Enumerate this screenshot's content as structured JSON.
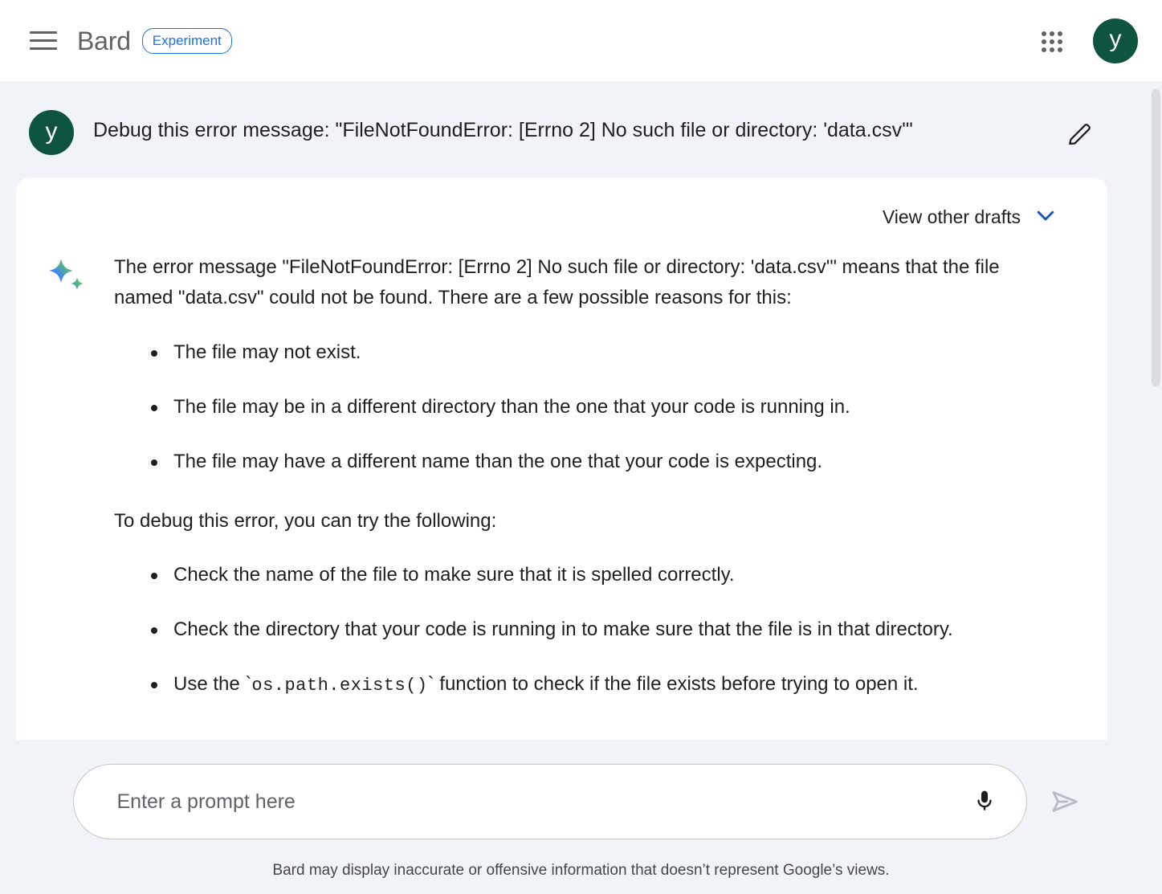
{
  "header": {
    "menu_icon": "hamburger-menu-icon",
    "brand": "Bard",
    "badge": "Experiment",
    "apps_icon": "apps-grid-icon",
    "avatar_initial": "y",
    "avatar_color": "#0f5440"
  },
  "prompt": {
    "avatar_initial": "y",
    "text": "Debug this error message: \"FileNotFoundError: [Errno 2] No such file or directory: 'data.csv'\"",
    "edit_icon": "pencil-edit-icon"
  },
  "response": {
    "drafts_label": "View other drafts",
    "drafts_chevron_icon": "chevron-down-icon",
    "drafts_chevron_color": "#1a73e8",
    "sparkle_icon": "bard-sparkle-icon",
    "intro": "The error message \"FileNotFoundError: [Errno 2] No such file or directory: 'data.csv'\" means that the file named \"data.csv\" could not be found. There are a few possible reasons for this:",
    "reasons": [
      "The file may not exist.",
      "The file may be in a different directory than the one that your code is running in.",
      "The file may have a different name than the one that your code is expecting."
    ],
    "steps_intro": "To debug this error, you can try the following:",
    "steps": [
      "Check the name of the file to make sure that it is spelled correctly.",
      "Check the directory that your code is running in to make sure that the file is in that directory."
    ],
    "step_code": {
      "before": "Use the `",
      "code": "os.path.exists()",
      "after": "` function to check if the file exists before trying to open it."
    }
  },
  "composer": {
    "placeholder": "Enter a prompt here",
    "value": "",
    "mic_icon": "microphone-icon",
    "send_icon": "send-arrow-icon"
  },
  "footer": {
    "disclaimer": "Bard may display inaccurate or offensive information that doesn’t represent Google’s views."
  }
}
